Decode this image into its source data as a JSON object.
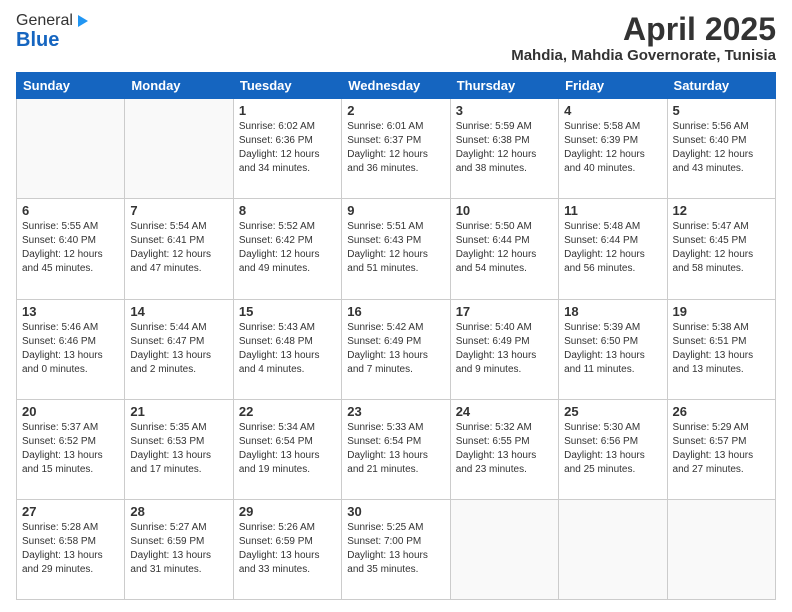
{
  "header": {
    "logo_general": "General",
    "logo_blue": "Blue",
    "month": "April 2025",
    "location": "Mahdia, Mahdia Governorate, Tunisia"
  },
  "days_of_week": [
    "Sunday",
    "Monday",
    "Tuesday",
    "Wednesday",
    "Thursday",
    "Friday",
    "Saturday"
  ],
  "weeks": [
    [
      {
        "day": "",
        "content": ""
      },
      {
        "day": "",
        "content": ""
      },
      {
        "day": "1",
        "content": "Sunrise: 6:02 AM\nSunset: 6:36 PM\nDaylight: 12 hours\nand 34 minutes."
      },
      {
        "day": "2",
        "content": "Sunrise: 6:01 AM\nSunset: 6:37 PM\nDaylight: 12 hours\nand 36 minutes."
      },
      {
        "day": "3",
        "content": "Sunrise: 5:59 AM\nSunset: 6:38 PM\nDaylight: 12 hours\nand 38 minutes."
      },
      {
        "day": "4",
        "content": "Sunrise: 5:58 AM\nSunset: 6:39 PM\nDaylight: 12 hours\nand 40 minutes."
      },
      {
        "day": "5",
        "content": "Sunrise: 5:56 AM\nSunset: 6:40 PM\nDaylight: 12 hours\nand 43 minutes."
      }
    ],
    [
      {
        "day": "6",
        "content": "Sunrise: 5:55 AM\nSunset: 6:40 PM\nDaylight: 12 hours\nand 45 minutes."
      },
      {
        "day": "7",
        "content": "Sunrise: 5:54 AM\nSunset: 6:41 PM\nDaylight: 12 hours\nand 47 minutes."
      },
      {
        "day": "8",
        "content": "Sunrise: 5:52 AM\nSunset: 6:42 PM\nDaylight: 12 hours\nand 49 minutes."
      },
      {
        "day": "9",
        "content": "Sunrise: 5:51 AM\nSunset: 6:43 PM\nDaylight: 12 hours\nand 51 minutes."
      },
      {
        "day": "10",
        "content": "Sunrise: 5:50 AM\nSunset: 6:44 PM\nDaylight: 12 hours\nand 54 minutes."
      },
      {
        "day": "11",
        "content": "Sunrise: 5:48 AM\nSunset: 6:44 PM\nDaylight: 12 hours\nand 56 minutes."
      },
      {
        "day": "12",
        "content": "Sunrise: 5:47 AM\nSunset: 6:45 PM\nDaylight: 12 hours\nand 58 minutes."
      }
    ],
    [
      {
        "day": "13",
        "content": "Sunrise: 5:46 AM\nSunset: 6:46 PM\nDaylight: 13 hours\nand 0 minutes."
      },
      {
        "day": "14",
        "content": "Sunrise: 5:44 AM\nSunset: 6:47 PM\nDaylight: 13 hours\nand 2 minutes."
      },
      {
        "day": "15",
        "content": "Sunrise: 5:43 AM\nSunset: 6:48 PM\nDaylight: 13 hours\nand 4 minutes."
      },
      {
        "day": "16",
        "content": "Sunrise: 5:42 AM\nSunset: 6:49 PM\nDaylight: 13 hours\nand 7 minutes."
      },
      {
        "day": "17",
        "content": "Sunrise: 5:40 AM\nSunset: 6:49 PM\nDaylight: 13 hours\nand 9 minutes."
      },
      {
        "day": "18",
        "content": "Sunrise: 5:39 AM\nSunset: 6:50 PM\nDaylight: 13 hours\nand 11 minutes."
      },
      {
        "day": "19",
        "content": "Sunrise: 5:38 AM\nSunset: 6:51 PM\nDaylight: 13 hours\nand 13 minutes."
      }
    ],
    [
      {
        "day": "20",
        "content": "Sunrise: 5:37 AM\nSunset: 6:52 PM\nDaylight: 13 hours\nand 15 minutes."
      },
      {
        "day": "21",
        "content": "Sunrise: 5:35 AM\nSunset: 6:53 PM\nDaylight: 13 hours\nand 17 minutes."
      },
      {
        "day": "22",
        "content": "Sunrise: 5:34 AM\nSunset: 6:54 PM\nDaylight: 13 hours\nand 19 minutes."
      },
      {
        "day": "23",
        "content": "Sunrise: 5:33 AM\nSunset: 6:54 PM\nDaylight: 13 hours\nand 21 minutes."
      },
      {
        "day": "24",
        "content": "Sunrise: 5:32 AM\nSunset: 6:55 PM\nDaylight: 13 hours\nand 23 minutes."
      },
      {
        "day": "25",
        "content": "Sunrise: 5:30 AM\nSunset: 6:56 PM\nDaylight: 13 hours\nand 25 minutes."
      },
      {
        "day": "26",
        "content": "Sunrise: 5:29 AM\nSunset: 6:57 PM\nDaylight: 13 hours\nand 27 minutes."
      }
    ],
    [
      {
        "day": "27",
        "content": "Sunrise: 5:28 AM\nSunset: 6:58 PM\nDaylight: 13 hours\nand 29 minutes."
      },
      {
        "day": "28",
        "content": "Sunrise: 5:27 AM\nSunset: 6:59 PM\nDaylight: 13 hours\nand 31 minutes."
      },
      {
        "day": "29",
        "content": "Sunrise: 5:26 AM\nSunset: 6:59 PM\nDaylight: 13 hours\nand 33 minutes."
      },
      {
        "day": "30",
        "content": "Sunrise: 5:25 AM\nSunset: 7:00 PM\nDaylight: 13 hours\nand 35 minutes."
      },
      {
        "day": "",
        "content": ""
      },
      {
        "day": "",
        "content": ""
      },
      {
        "day": "",
        "content": ""
      }
    ]
  ]
}
